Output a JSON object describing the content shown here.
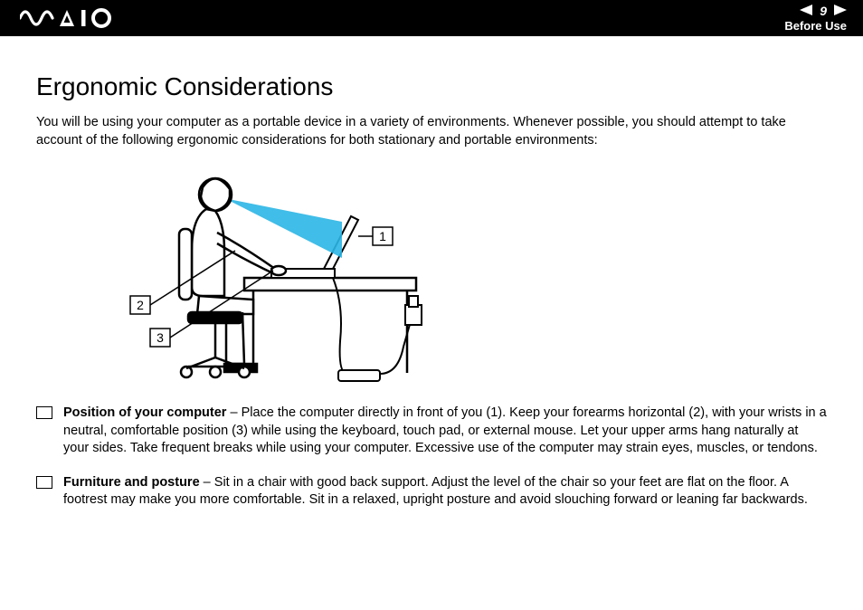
{
  "header": {
    "logo_alt": "VAIO",
    "page_number": "9",
    "section_label": "Before Use"
  },
  "title": "Ergonomic Considerations",
  "intro": "You will be using your computer as a portable device in a variety of environments. Whenever possible, you should attempt to take account of the following ergonomic considerations for both stationary and portable environments:",
  "diagram": {
    "labels": {
      "screen": "1",
      "forearm": "2",
      "wrist": "3"
    }
  },
  "bullets": [
    {
      "title": "Position of your computer",
      "body": " – Place the computer directly in front of you (1). Keep your forearms horizontal (2), with your wrists in a neutral, comfortable position (3) while using the keyboard, touch pad, or external mouse. Let your upper arms hang naturally at your sides. Take frequent breaks while using your computer. Excessive use of the computer may strain eyes, muscles, or tendons."
    },
    {
      "title": "Furniture and posture",
      "body": " – Sit in a chair with good back support. Adjust the level of the chair so your feet are flat on the floor. A footrest may make you more comfortable. Sit in a relaxed, upright posture and avoid slouching forward or leaning far backwards."
    }
  ]
}
